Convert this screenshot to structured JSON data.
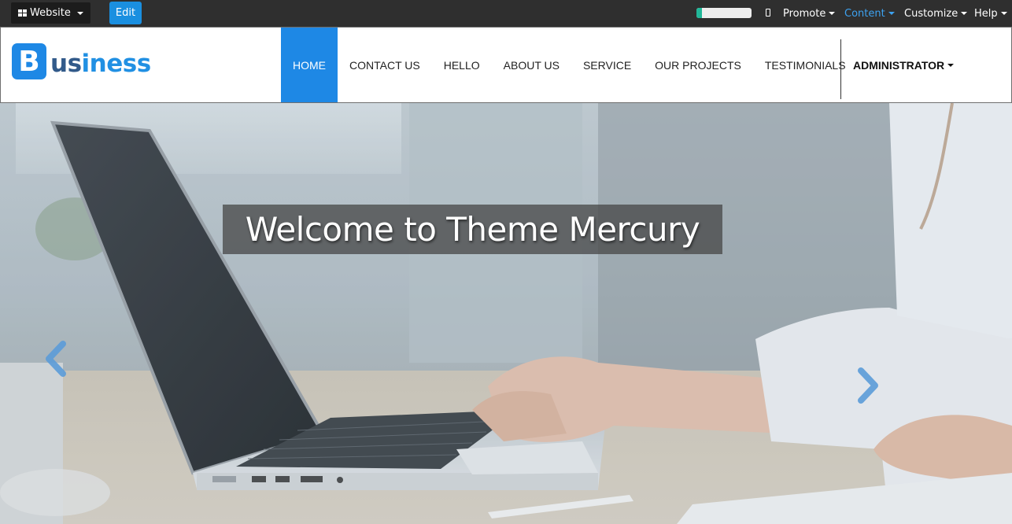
{
  "admin_bar": {
    "website_label": "Website",
    "edit_label": "Edit",
    "progress": 0.1,
    "menus": {
      "promote": "Promote",
      "content": "Content",
      "customize": "Customize",
      "help": "Help"
    },
    "colors": {
      "bar": "#2f2f2f",
      "edit": "#1a8fe0",
      "content_active": "#3da2f0",
      "progress": "#21b799"
    }
  },
  "logo": {
    "initial": "B",
    "rest_dark": "us",
    "rest_blue": "iness"
  },
  "nav": {
    "items": [
      {
        "label": "HOME",
        "active": true
      },
      {
        "label": "CONTACT US"
      },
      {
        "label": "HELLO"
      },
      {
        "label": "ABOUT US"
      },
      {
        "label": "SERVICE"
      },
      {
        "label": "OUR PROJECTS"
      },
      {
        "label": "TESTIMONIALS"
      }
    ],
    "admin_label": "ADMINISTRATOR",
    "active_color": "#1e88e5"
  },
  "hero": {
    "caption": "Welcome to Theme Mercury",
    "prev_icon": "chevron-left-icon",
    "next_icon": "chevron-right-icon"
  }
}
